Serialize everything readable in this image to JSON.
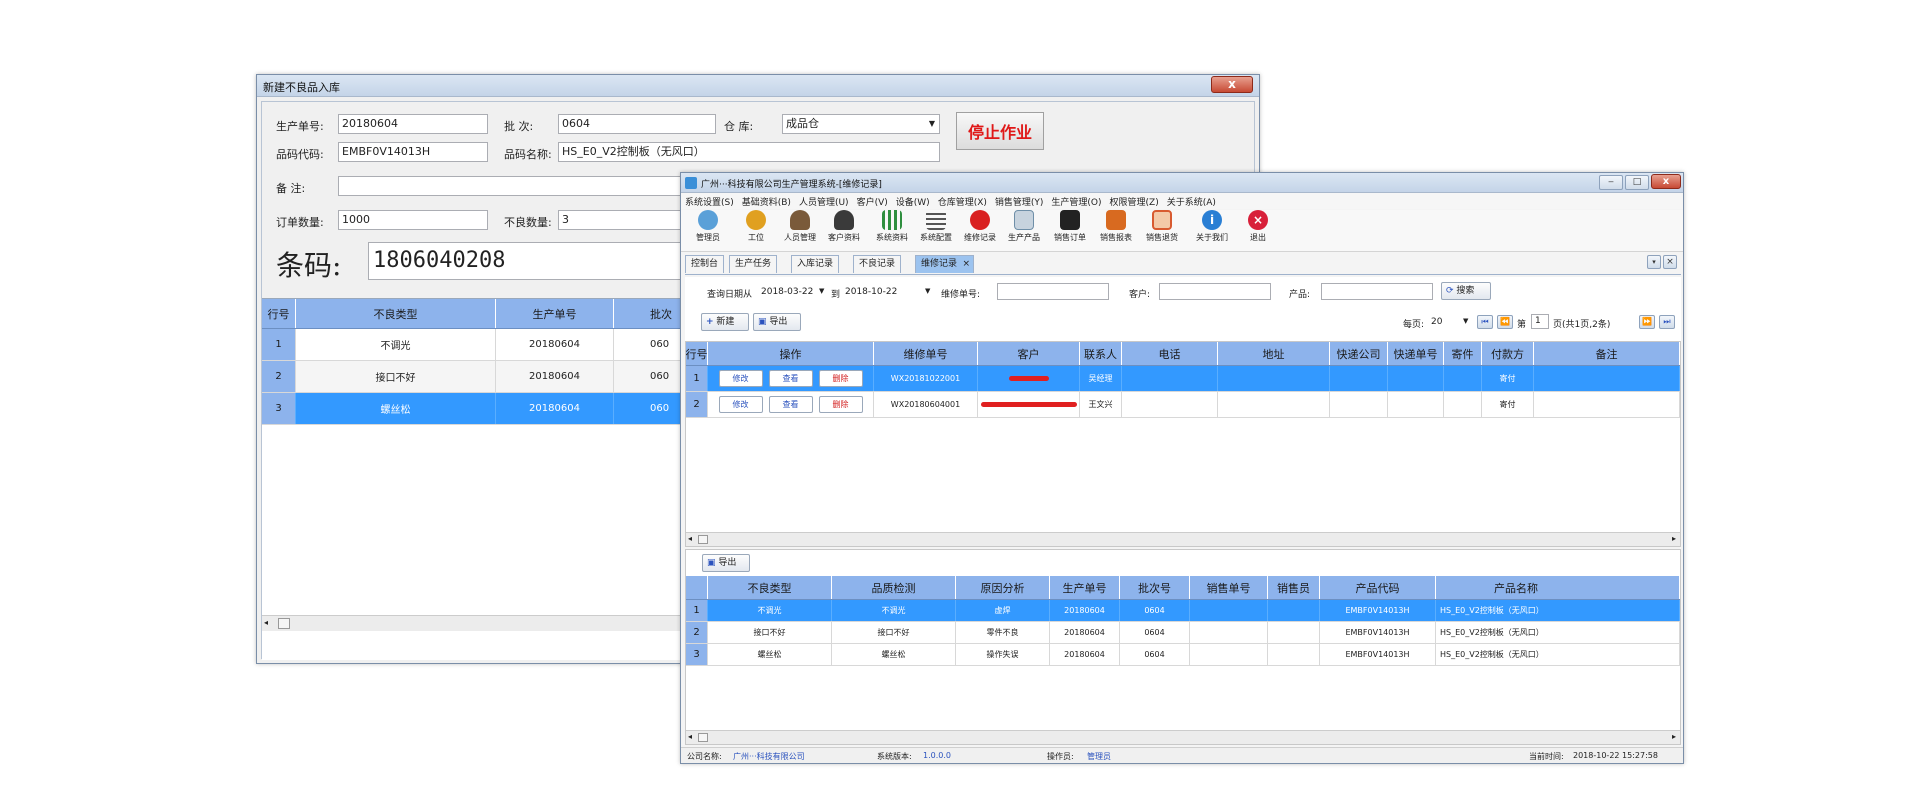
{
  "win1": {
    "title": "新建不良品入库",
    "close_label": "x",
    "fields": {
      "production_no_label": "生产单号:",
      "production_no": "20180604",
      "batch_label": "批    次:",
      "batch": "0604",
      "warehouse_label": "仓    库:",
      "warehouse": "成品仓",
      "product_code_label": "品码代码:",
      "product_code": "EMBF0V14013H",
      "product_name_label": "品码名称:",
      "product_name": "HS_E0_V2控制板（无风口）",
      "remark_label": "备    注:",
      "remark": "",
      "order_qty_label": "订单数量:",
      "order_qty": "1000",
      "defect_qty_label": "不良数量:",
      "defect_qty": "3",
      "stop_button": "停止作业",
      "barcode_label": "条码:",
      "barcode": "1806040208"
    },
    "grid": {
      "headers": [
        "行号",
        "不良类型",
        "生产单号",
        "批次"
      ],
      "rows": [
        {
          "no": "1",
          "type": "不调光",
          "prod": "20180604",
          "batch": "060"
        },
        {
          "no": "2",
          "type": "接口不好",
          "prod": "20180604",
          "batch": "060"
        },
        {
          "no": "3",
          "type": "螺丝松",
          "prod": "20180604",
          "batch": "060"
        }
      ]
    }
  },
  "win2": {
    "title": "广州···科技有限公司生产管理系统-[维修记录]",
    "menu": [
      "系统设置(S)",
      "基础资料(B)",
      "人员管理(U)",
      "客户(V)",
      "设备(W)",
      "仓库管理(X)",
      "销售管理(Y)",
      "生产管理(O)",
      "权限管理(Z)",
      "关于系统(A)"
    ],
    "toolbar": [
      {
        "label": "管理员",
        "icon": "admin-icon",
        "color": "#5aa0d8"
      },
      {
        "label": "工位",
        "icon": "workstation-icon",
        "color": "#e0a020"
      },
      {
        "label": "人员管理",
        "icon": "users-icon",
        "color": "#7a5a3a"
      },
      {
        "label": "客户资料",
        "icon": "customer-icon",
        "color": "#3a3a3a"
      },
      {
        "label": "系统资料",
        "icon": "system-data-icon",
        "color": "#2f8f3f"
      },
      {
        "label": "系统配置",
        "icon": "config-icon",
        "color": "#555555"
      },
      {
        "label": "维修记录",
        "icon": "repair-icon",
        "color": "#d92020"
      },
      {
        "label": "生产产品",
        "icon": "product-icon",
        "color": "#6f8fa8"
      },
      {
        "label": "销售订单",
        "icon": "sales-order-icon",
        "color": "#222222"
      },
      {
        "label": "销售报表",
        "icon": "sales-report-icon",
        "color": "#d86a20"
      },
      {
        "label": "销售退货",
        "icon": "sales-return-icon",
        "color": "#d85a30"
      },
      {
        "label": "关于我们",
        "icon": "info-icon",
        "color": "#2a7fd4"
      },
      {
        "label": "退出",
        "icon": "exit-icon",
        "color": "#d8203a"
      }
    ],
    "tabs": [
      "控制台",
      "生产任务",
      "入库记录",
      "不良记录",
      "维修记录"
    ],
    "filter": {
      "date_from_label": "查询日期从",
      "date_from": "2018-03-22",
      "date_to_label": "到",
      "date_to": "2018-10-22",
      "repair_no_label": "维修单号:",
      "customer_label": "客户:",
      "product_label": "产品:",
      "search_label": "搜索"
    },
    "actions": {
      "new": "新建",
      "export": "导出"
    },
    "pager": {
      "per_page_label": "每页:",
      "per_page": "20",
      "page_label": "第",
      "page": "1",
      "page_total": "页(共1页,2条)"
    },
    "top_grid": {
      "headers": [
        "行号",
        "操作",
        "维修单号",
        "客户",
        "联系人",
        "电话",
        "地址",
        "快递公司",
        "快递单号",
        "寄件",
        "付款方",
        "备注"
      ],
      "rows": [
        {
          "no": "1",
          "ops": [
            "修改",
            "查看",
            "删除"
          ],
          "repair_no": "WX20181022001",
          "customer": "",
          "contact": "吴经理",
          "pay": "寄付"
        },
        {
          "no": "2",
          "ops": [
            "修改",
            "查看",
            "删除"
          ],
          "repair_no": "WX20180604001",
          "customer": "",
          "contact": "王文兴",
          "pay": "寄付"
        }
      ]
    },
    "bottom_export": "导出",
    "bottom_grid": {
      "headers": [
        "",
        "不良类型",
        "品质检测",
        "原因分析",
        "生产单号",
        "批次号",
        "销售单号",
        "销售员",
        "产品代码",
        "产品名称"
      ],
      "rows": [
        {
          "no": "1",
          "type": "不调光",
          "check": "不调光",
          "reason": "虚焊",
          "prod": "20180604",
          "batch": "0604",
          "code": "EMBF0V14013H",
          "name": "HS_E0_V2控制板（无风口）"
        },
        {
          "no": "2",
          "type": "接口不好",
          "check": "接口不好",
          "reason": "零件不良",
          "prod": "20180604",
          "batch": "0604",
          "code": "EMBF0V14013H",
          "name": "HS_E0_V2控制板（无风口）"
        },
        {
          "no": "3",
          "type": "螺丝松",
          "check": "螺丝松",
          "reason": "操作失误",
          "prod": "20180604",
          "batch": "0604",
          "code": "EMBF0V14013H",
          "name": "HS_E0_V2控制板（无风口）"
        }
      ]
    },
    "status": {
      "company_label": "公司名称:",
      "company": "广州···科技有限公司",
      "version_label": "系统版本:",
      "version": "1.0.0.0",
      "operator_label": "操作员:",
      "operator": "管理员",
      "time_label": "当前时间:",
      "time": "2018-10-22 15:27:58"
    },
    "colors": {
      "header_blue": "#8db3ec",
      "select_blue": "#3399ff",
      "redact_red": "#e02020"
    }
  }
}
